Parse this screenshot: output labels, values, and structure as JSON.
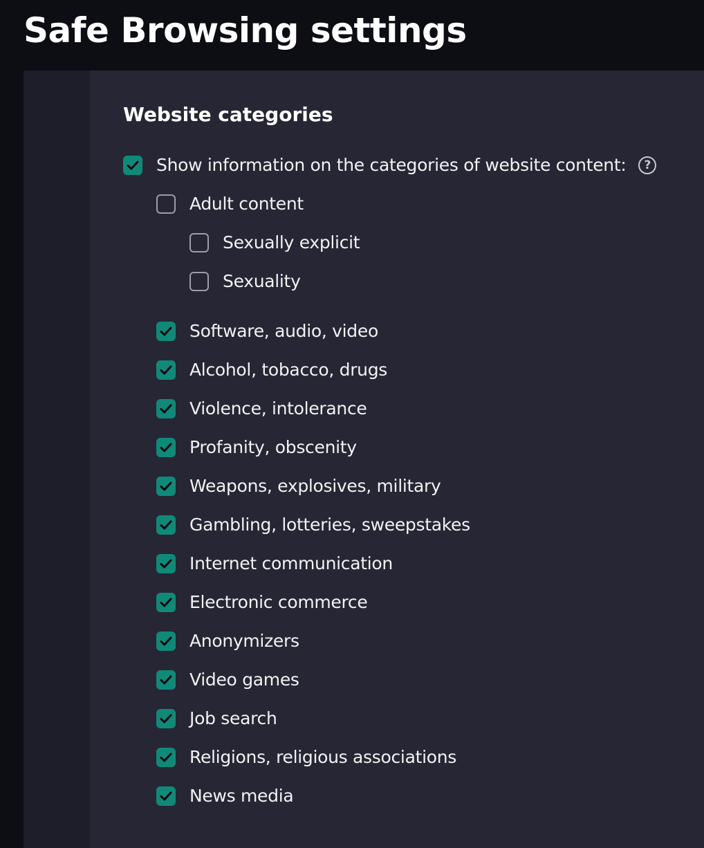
{
  "header": {
    "title": "Safe Browsing settings"
  },
  "section": {
    "title": "Website categories"
  },
  "colors": {
    "accent": "#0f8a78",
    "background": "#0d0d14",
    "panel": "#272634"
  },
  "master_option": {
    "label": "Show information on the categories of website content:",
    "checked": true,
    "help_icon": "question-circle-icon"
  },
  "adult": {
    "label": "Adult content",
    "checked": false,
    "children": [
      {
        "label": "Sexually explicit",
        "checked": false
      },
      {
        "label": "Sexuality",
        "checked": false
      }
    ]
  },
  "categories": [
    {
      "label": "Software, audio, video",
      "checked": true
    },
    {
      "label": "Alcohol, tobacco, drugs",
      "checked": true
    },
    {
      "label": "Violence, intolerance",
      "checked": true
    },
    {
      "label": "Profanity, obscenity",
      "checked": true
    },
    {
      "label": "Weapons, explosives, military",
      "checked": true
    },
    {
      "label": "Gambling, lotteries, sweepstakes",
      "checked": true
    },
    {
      "label": "Internet communication",
      "checked": true
    },
    {
      "label": "Electronic commerce",
      "checked": true
    },
    {
      "label": "Anonymizers",
      "checked": true
    },
    {
      "label": "Video games",
      "checked": true
    },
    {
      "label": "Job search",
      "checked": true
    },
    {
      "label": "Religions, religious associations",
      "checked": true
    },
    {
      "label": "News media",
      "checked": true
    }
  ]
}
